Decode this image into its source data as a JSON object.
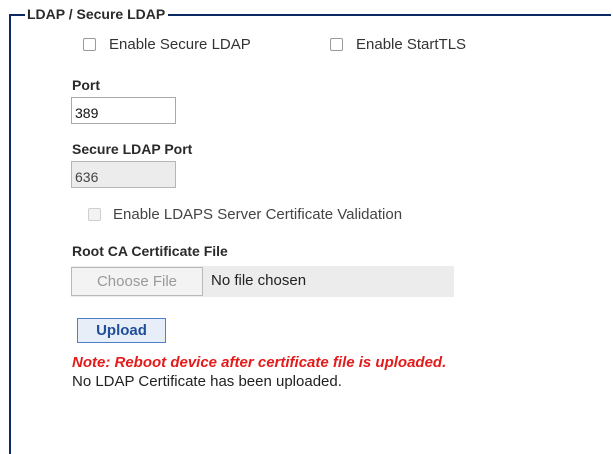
{
  "legend": "LDAP / Secure LDAP",
  "options": {
    "enable_secure_ldap": {
      "label": "Enable Secure LDAP",
      "checked": false
    },
    "enable_starttls": {
      "label": "Enable StartTLS",
      "checked": false
    }
  },
  "port": {
    "label": "Port",
    "value": "389"
  },
  "secure_port": {
    "label": "Secure LDAP Port",
    "value": "636"
  },
  "cert_validation": {
    "label": "Enable LDAPS Server Certificate Validation",
    "checked": false,
    "disabled": true
  },
  "root_ca": {
    "label": "Root CA Certificate File",
    "choose_button": "Choose File",
    "no_file_text": "No file chosen"
  },
  "upload_button": "Upload",
  "note": "Note: Reboot device after certificate file is uploaded.",
  "status_text": "No LDAP Certificate has been uploaded.",
  "colors": {
    "border": "#0b2a63",
    "note": "#e31b1b",
    "upload_border": "#4f7fc8",
    "upload_text": "#1f4f99"
  }
}
